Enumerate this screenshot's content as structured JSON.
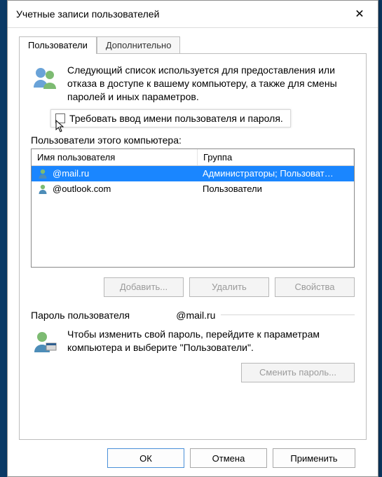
{
  "window": {
    "title": "Учетные записи пользователей"
  },
  "tabs": {
    "users": "Пользователи",
    "advanced": "Дополнительно"
  },
  "intro": "Следующий список используется для предоставления или отказа в доступе к вашему компьютеру, а также для смены паролей и иных параметров.",
  "checkbox_label": "Требовать ввод имени пользователя и пароля.",
  "section_label": "Пользователи этого компьютера:",
  "columns": {
    "name": "Имя пользователя",
    "group": "Группа"
  },
  "rows": [
    {
      "name": "@mail.ru",
      "group": "Администраторы; Пользоват…",
      "selected": true
    },
    {
      "name": "@outlook.com",
      "group": "Пользователи",
      "selected": false
    }
  ],
  "buttons": {
    "add": "Добавить...",
    "remove": "Удалить",
    "props": "Свойства"
  },
  "pwd_group_label": "Пароль пользователя                 @mail.ru",
  "pwd_text": "Чтобы изменить свой пароль, перейдите к параметрам компьютера и выберите \"Пользователи\".",
  "pwd_button": "Сменить пароль...",
  "footer": {
    "ok": "ОК",
    "cancel": "Отмена",
    "apply": "Применить"
  }
}
